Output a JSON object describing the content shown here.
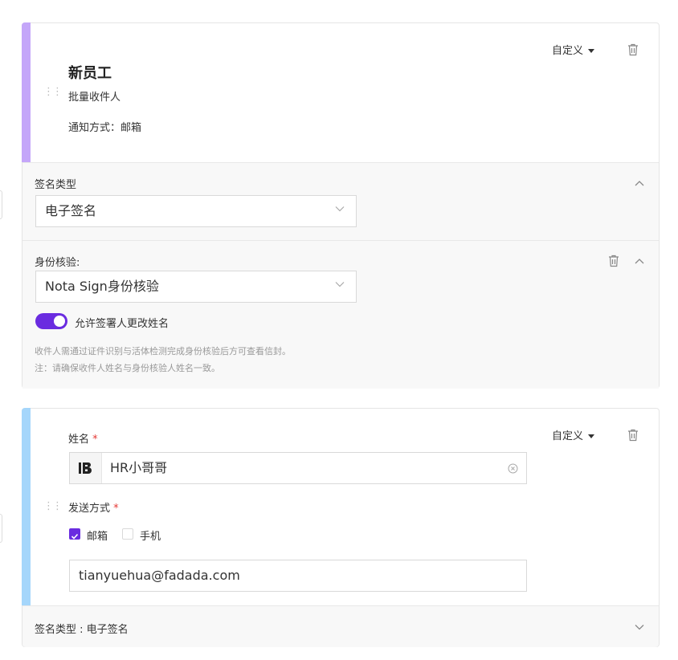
{
  "card1": {
    "title": "新员工",
    "subtitle": "批量收件人",
    "notify_label": "通知方式：",
    "notify_value": "邮箱",
    "custom_label": "自定义",
    "sign_type_section": {
      "label": "签名类型",
      "select_value": "电子签名"
    },
    "identity_section": {
      "label": "身份核验:",
      "select_value": "Nota Sign身份核验",
      "toggle_label": "允许签署人更改姓名",
      "toggle_on": true,
      "hint1": "收件人需通过证件识别与活体检测完成身份核验后方可查看信封。",
      "hint2": "注：请确保收件人姓名与身份核验人姓名一致。"
    }
  },
  "card2": {
    "custom_label": "自定义",
    "name_label": "姓名",
    "required_mark": "*",
    "name_value": "HR小哥哥",
    "send_label": "发送方式",
    "options": [
      {
        "label": "邮箱",
        "checked": true
      },
      {
        "label": "手机",
        "checked": false
      }
    ],
    "email_value": "tianyuehua@fadada.com",
    "sign_type_summary": "签名类型 : 电子签名"
  },
  "colors": {
    "accent_purple": "#c4a6f9",
    "accent_blue": "#a5d6fb",
    "primary": "#6a2ce0"
  }
}
